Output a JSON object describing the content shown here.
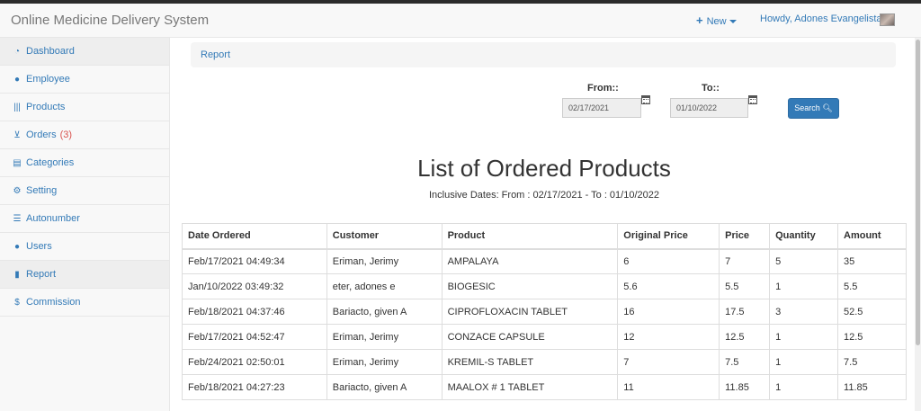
{
  "navbar": {
    "brand": "Online Medicine Delivery System",
    "new_label": "New",
    "user_label": "Howdy, Adones Evangelista"
  },
  "sidebar": {
    "items": [
      {
        "label": "Dashboard",
        "icon": "dashboard-icon"
      },
      {
        "label": "Employee",
        "icon": "users-icon"
      },
      {
        "label": "Products",
        "icon": "barcode-icon"
      },
      {
        "label": "Orders",
        "icon": "cart-icon",
        "badge": "(3)"
      },
      {
        "label": "Categories",
        "icon": "list-icon"
      },
      {
        "label": "Setting",
        "icon": "gears-icon"
      },
      {
        "label": "Autonumber",
        "icon": "list-alt-icon"
      },
      {
        "label": "Users",
        "icon": "user-icon"
      },
      {
        "label": "Report",
        "icon": "file-icon"
      },
      {
        "label": "Commission",
        "icon": "dollar-icon"
      }
    ]
  },
  "breadcrumb": "Report",
  "filters": {
    "from_label": "From::",
    "from_value": "02/17/2021",
    "to_label": "To::",
    "to_value": "01/10/2022",
    "search_label": "Search"
  },
  "report": {
    "title": "List of Ordered Products",
    "subtitle": "Inclusive Dates: From : 02/17/2021 - To : 01/10/2022"
  },
  "table": {
    "headers": [
      "Date Ordered",
      "Customer",
      "Product",
      "Original Price",
      "Price",
      "Quantity",
      "Amount"
    ],
    "rows": [
      [
        "Feb/17/2021 04:49:34",
        "Eriman, Jerimy",
        "AMPALAYA",
        "6",
        "7",
        "5",
        "35"
      ],
      [
        "Jan/10/2022 03:49:32",
        "eter, adones e",
        "BIOGESIC",
        "5.6",
        "5.5",
        "1",
        "5.5"
      ],
      [
        "Feb/18/2021 04:37:46",
        "Bariacto, given A",
        "CIPROFLOXACIN TABLET",
        "16",
        "17.5",
        "3",
        "52.5"
      ],
      [
        "Feb/17/2021 04:52:47",
        "Eriman, Jerimy",
        "CONZACE CAPSULE",
        "12",
        "12.5",
        "1",
        "12.5"
      ],
      [
        "Feb/24/2021 02:50:01",
        "Eriman, Jerimy",
        "KREMIL-S TABLET",
        "7",
        "7.5",
        "1",
        "7.5"
      ],
      [
        "Feb/18/2021 04:27:23",
        "Bariacto, given A",
        "MAALOX # 1 TABLET",
        "11",
        "11.85",
        "1",
        "11.85"
      ]
    ]
  },
  "colors": {
    "link": "#337ab7",
    "badge": "#d9534f",
    "button": "#337ab7"
  }
}
